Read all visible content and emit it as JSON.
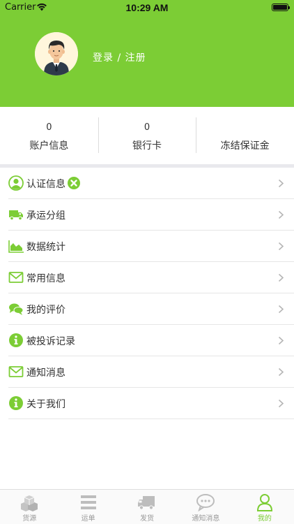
{
  "status_bar": {
    "carrier": "Carrier",
    "time": "10:29 AM"
  },
  "header": {
    "login_text": "登录 / 注册",
    "bg_color": "#7ccd35"
  },
  "stats": [
    {
      "value": "0",
      "label": "账户信息"
    },
    {
      "value": "0",
      "label": "银行卡"
    },
    {
      "value": "",
      "label": "冻结保证金"
    }
  ],
  "menu": [
    {
      "label": "认证信息",
      "icon": "user-circle-icon"
    },
    {
      "label": "承运分组",
      "icon": "truck-icon"
    },
    {
      "label": "数据统计",
      "icon": "area-chart-icon"
    },
    {
      "label": "常用信息",
      "icon": "envelope-icon"
    },
    {
      "label": "我的评价",
      "icon": "comments-icon"
    },
    {
      "label": "被投诉记录",
      "icon": "info-circle-icon"
    },
    {
      "label": "通知消息",
      "icon": "envelope-icon"
    },
    {
      "label": "关于我们",
      "icon": "info-circle-icon"
    }
  ],
  "tabbar": [
    {
      "label": "货源",
      "icon": "boxes-icon"
    },
    {
      "label": "运单",
      "icon": "list-icon"
    },
    {
      "label": "发货",
      "icon": "truck-icon"
    },
    {
      "label": "通知消息",
      "icon": "chat-bubble-icon"
    },
    {
      "label": "我的",
      "icon": "person-icon",
      "active": true
    }
  ],
  "colors": {
    "accent": "#7ccd35",
    "inactive": "#999999",
    "badge": "#7ccd35"
  }
}
